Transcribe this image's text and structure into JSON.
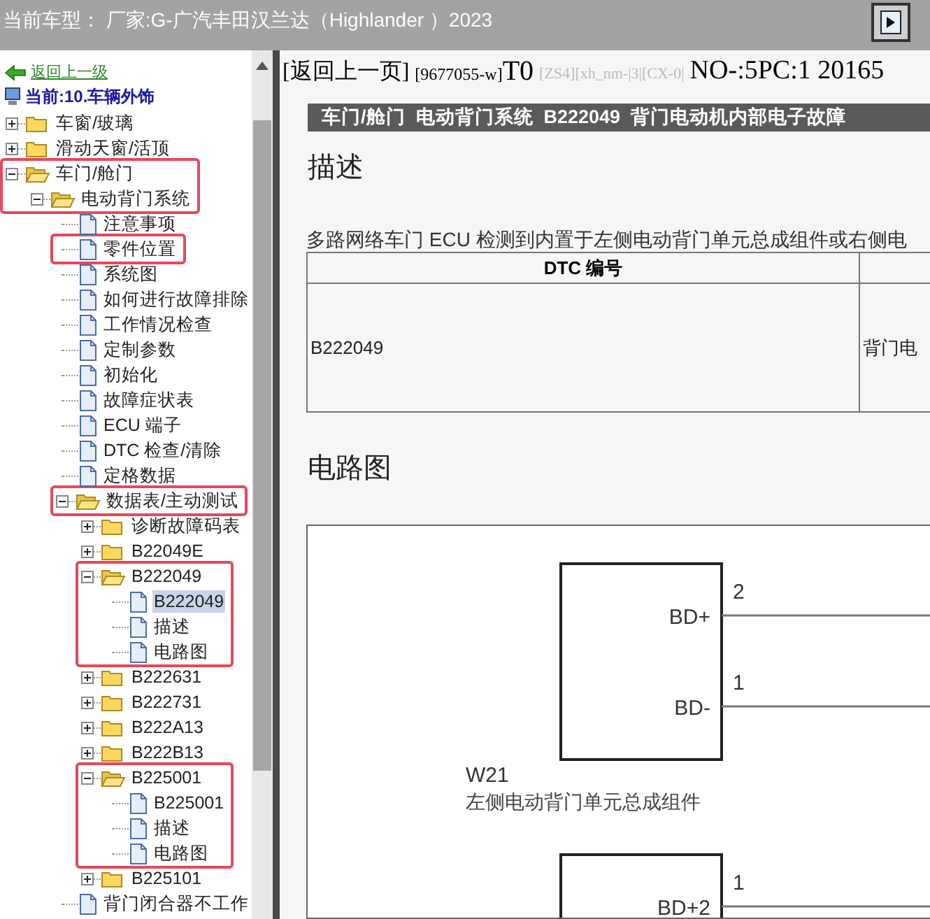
{
  "top_bar": {
    "title": "当前车型：  厂家:G-广汽丰田汉兰达（Highlander ）2023"
  },
  "nav": {
    "back_link": "返回上一级",
    "current": "当前:10.车辆外饰"
  },
  "tree": [
    {
      "label": "车窗/玻璃",
      "kind": "folder",
      "expanded": false,
      "selected": false
    },
    {
      "label": "滑动天窗/活顶",
      "kind": "folder",
      "expanded": false,
      "selected": false
    },
    {
      "label": "车门/舱门",
      "kind": "folder",
      "expanded": true,
      "selected": false,
      "framed": true,
      "frame_first_child": true,
      "children": [
        {
          "label": "电动背门系统",
          "kind": "folder",
          "expanded": true,
          "selected": false,
          "children": [
            {
              "label": "注意事项",
              "kind": "doc",
              "selected": false
            },
            {
              "label": "零件位置",
              "kind": "doc",
              "selected": false,
              "framed": true
            },
            {
              "label": "系统图",
              "kind": "doc",
              "selected": false
            },
            {
              "label": "如何进行故障排除",
              "kind": "doc",
              "selected": false
            },
            {
              "label": "工作情况检查",
              "kind": "doc",
              "selected": false
            },
            {
              "label": "定制参数",
              "kind": "doc",
              "selected": false
            },
            {
              "label": "初始化",
              "kind": "doc",
              "selected": false
            },
            {
              "label": "故障症状表",
              "kind": "doc",
              "selected": false
            },
            {
              "label": "ECU 端子",
              "kind": "doc",
              "selected": false
            },
            {
              "label": "DTC 检查/清除",
              "kind": "doc",
              "selected": false
            },
            {
              "label": "定格数据",
              "kind": "doc",
              "selected": false
            },
            {
              "label": "数据表/主动测试",
              "kind": "folder",
              "expanded": true,
              "selected": false,
              "framed": true,
              "children": [
                {
                  "label": "诊断故障码表",
                  "kind": "folder",
                  "expanded": false,
                  "selected": false
                },
                {
                  "label": "B22049E",
                  "kind": "folder",
                  "expanded": false,
                  "selected": false
                },
                {
                  "label": "B222049",
                  "kind": "folder",
                  "expanded": true,
                  "selected": false,
                  "framed": true,
                  "frame_children": true,
                  "children": [
                    {
                      "label": "B222049",
                      "kind": "doc",
                      "selected": true
                    },
                    {
                      "label": "描述",
                      "kind": "doc",
                      "selected": false
                    },
                    {
                      "label": "电路图",
                      "kind": "doc",
                      "selected": false
                    }
                  ]
                },
                {
                  "label": "B222631",
                  "kind": "folder",
                  "expanded": false,
                  "selected": false
                },
                {
                  "label": "B222731",
                  "kind": "folder",
                  "expanded": false,
                  "selected": false
                },
                {
                  "label": "B222A13",
                  "kind": "folder",
                  "expanded": false,
                  "selected": false
                },
                {
                  "label": "B222B13",
                  "kind": "folder",
                  "expanded": false,
                  "selected": false
                },
                {
                  "label": "B225001",
                  "kind": "folder",
                  "expanded": true,
                  "selected": false,
                  "framed": true,
                  "frame_children": true,
                  "children": [
                    {
                      "label": "B225001",
                      "kind": "doc",
                      "selected": false
                    },
                    {
                      "label": "描述",
                      "kind": "doc",
                      "selected": false
                    },
                    {
                      "label": "电路图",
                      "kind": "doc",
                      "selected": false
                    }
                  ]
                },
                {
                  "label": "B225101",
                  "kind": "folder",
                  "expanded": false,
                  "selected": false
                }
              ]
            },
            {
              "label": "背门闭合器不工作",
              "kind": "doc",
              "selected": false
            }
          ]
        }
      ]
    }
  ],
  "content": {
    "back_link": "[返回上一页]",
    "doc_id": "[9677055-w]",
    "code": "T0",
    "tags": "[ZS4][xh_nm-|3|[CX-0|",
    "number": "NO-:5PC:1 20165",
    "title_bar": "车门/舱门  电动背门系统  B222049  背门电动机内部电子故障",
    "description_heading": "描述",
    "description": "多路网络车门 ECU 检测到内置于左侧电动背门单元总成组件或右侧电",
    "table": {
      "columns": [
        "DTC 编号"
      ],
      "rows": [
        [
          "B222049",
          "背门电"
        ]
      ]
    },
    "circuit_heading": "电路图",
    "diagram": {
      "components": [
        {
          "code": "W21",
          "name": "左侧电动背门单元总成组件",
          "pins": [
            {
              "number": "2",
              "name": "BD+"
            },
            {
              "number": "1",
              "name": "BD-"
            }
          ]
        },
        {
          "pins": [
            {
              "number": "1",
              "name": "BD+2"
            }
          ]
        }
      ]
    }
  }
}
